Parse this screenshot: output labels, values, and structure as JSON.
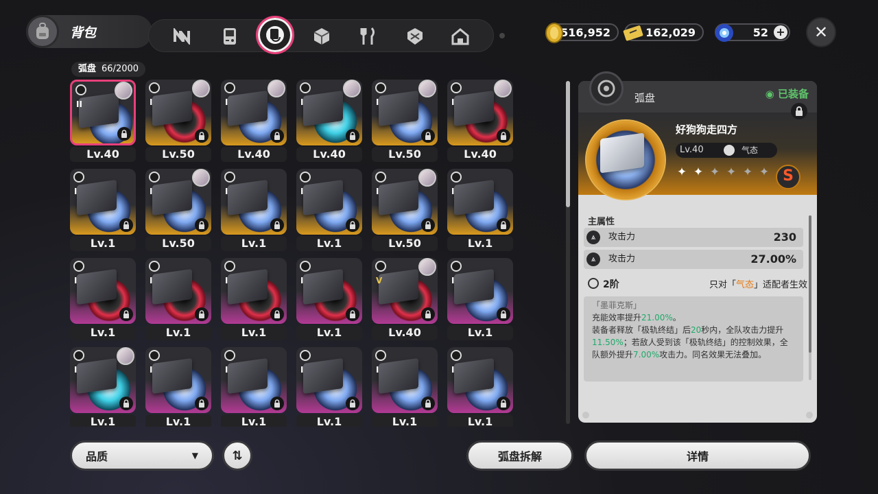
{
  "header": {
    "title": "背包",
    "tabs": [
      {
        "name": "tab-n-icon"
      },
      {
        "name": "tab-gameboy-icon"
      },
      {
        "name": "tab-disc-icon",
        "active": true
      },
      {
        "name": "tab-cube-icon"
      },
      {
        "name": "tab-food-icon"
      },
      {
        "name": "tab-shield-icon"
      },
      {
        "name": "tab-home-icon"
      }
    ]
  },
  "currencies": {
    "coins": "516,952",
    "tickets": "162,029",
    "energy": "52"
  },
  "inventory": {
    "label": "弧盘",
    "count": "66/2000",
    "items": [
      {
        "lv": "Lv.40",
        "rank": "II",
        "tier": "gold",
        "disc": "blue",
        "portrait": true,
        "selected": true
      },
      {
        "lv": "Lv.50",
        "rank": "I",
        "tier": "gold",
        "disc": "red",
        "portrait": true
      },
      {
        "lv": "Lv.40",
        "rank": "I",
        "tier": "gold",
        "disc": "blue",
        "portrait": true
      },
      {
        "lv": "Lv.40",
        "rank": "I",
        "tier": "gold",
        "disc": "teal",
        "portrait": true
      },
      {
        "lv": "Lv.50",
        "rank": "I",
        "tier": "gold",
        "disc": "blue",
        "portrait": true
      },
      {
        "lv": "Lv.40",
        "rank": "I",
        "tier": "gold",
        "disc": "red",
        "portrait": true
      },
      {
        "lv": "Lv.1",
        "rank": "I",
        "tier": "gold",
        "disc": "blue",
        "portrait": false
      },
      {
        "lv": "Lv.50",
        "rank": "I",
        "tier": "gold",
        "disc": "blue",
        "portrait": true
      },
      {
        "lv": "Lv.1",
        "rank": "I",
        "tier": "gold",
        "disc": "blue",
        "portrait": false
      },
      {
        "lv": "Lv.1",
        "rank": "I",
        "tier": "gold",
        "disc": "blue",
        "portrait": false
      },
      {
        "lv": "Lv.50",
        "rank": "I",
        "tier": "gold",
        "disc": "blue",
        "portrait": true
      },
      {
        "lv": "Lv.1",
        "rank": "I",
        "tier": "gold",
        "disc": "blue",
        "portrait": false
      },
      {
        "lv": "Lv.1",
        "rank": "I",
        "tier": "purple",
        "disc": "red",
        "portrait": false
      },
      {
        "lv": "Lv.1",
        "rank": "I",
        "tier": "purple",
        "disc": "red",
        "portrait": false
      },
      {
        "lv": "Lv.1",
        "rank": "I",
        "tier": "purple",
        "disc": "red",
        "portrait": false
      },
      {
        "lv": "Lv.1",
        "rank": "I",
        "tier": "purple",
        "disc": "red",
        "portrait": false
      },
      {
        "lv": "Lv.40",
        "rank": "V",
        "tier": "purple",
        "disc": "red",
        "portrait": true
      },
      {
        "lv": "Lv.1",
        "rank": "I",
        "tier": "purple",
        "disc": "blue",
        "portrait": false
      },
      {
        "lv": "Lv.1",
        "rank": "I",
        "tier": "purple",
        "disc": "teal",
        "portrait": true
      },
      {
        "lv": "Lv.1",
        "rank": "I",
        "tier": "purple",
        "disc": "blue",
        "portrait": false
      },
      {
        "lv": "Lv.1",
        "rank": "I",
        "tier": "purple",
        "disc": "blue",
        "portrait": false
      },
      {
        "lv": "Lv.1",
        "rank": "I",
        "tier": "purple",
        "disc": "blue",
        "portrait": false
      },
      {
        "lv": "Lv.1",
        "rank": "I",
        "tier": "purple",
        "disc": "blue",
        "portrait": false
      },
      {
        "lv": "Lv.1",
        "rank": "I",
        "tier": "purple",
        "disc": "blue",
        "portrait": false
      }
    ]
  },
  "bottom": {
    "filter_label": "品质",
    "dismantle_label": "弧盘拆解",
    "detail_label": "详情"
  },
  "detail": {
    "type_label": "弧盘",
    "equipped_label": "已装备",
    "name": "好狗狗走四方",
    "level": "Lv.40",
    "element": "气态",
    "rank_letter": "S",
    "stars_filled": 2,
    "stars_total": 6,
    "main_attr_title": "主属性",
    "stats": [
      {
        "name": "攻击力",
        "value": "230"
      },
      {
        "name": "攻击力",
        "value": "27.00%"
      }
    ],
    "skill_level": "2阶",
    "skill_cond_prefix": "只对「",
    "skill_cond_element": "气态",
    "skill_cond_suffix": "」适配者生效",
    "desc_name": "「墨菲克斯」",
    "desc_p1": "充能效率提升",
    "desc_v1": "21.00%",
    "desc_p2": "。",
    "desc_p3": "装备者释放「极轨终结」后",
    "desc_v2": "20",
    "desc_p4": "秒内，全队攻击力提升",
    "desc_v3": "11.50%",
    "desc_p5": "；若敌人受到该「极轨终结」的控制效果，全队额外提升",
    "desc_v4": "7.00%",
    "desc_p6": "攻击力。同名效果无法叠加。"
  }
}
